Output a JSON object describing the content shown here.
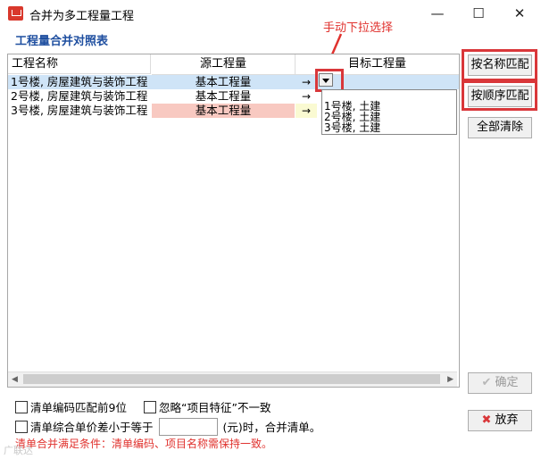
{
  "window": {
    "title": "合并为多工程量工程",
    "controls": {
      "minimize": "—",
      "maximize": "☐",
      "close": "✕"
    }
  },
  "section_title": "工程量合并对照表",
  "annotation": "手动下拉选择",
  "table": {
    "headers": [
      "工程名称",
      "源工程量",
      "目标工程量"
    ],
    "rows": [
      {
        "name": "1号楼, 房屋建筑与装饰工程",
        "source": "基本工程量",
        "arrow": "→",
        "target": ""
      },
      {
        "name": "2号楼, 房屋建筑与装饰工程",
        "source": "基本工程量",
        "arrow": "→",
        "target": ""
      },
      {
        "name": "3号楼, 房屋建筑与装饰工程",
        "source": "基本工程量",
        "arrow": "→",
        "target": ""
      }
    ],
    "dropdown_options": [
      "1号楼, 土建",
      "2号楼, 土建",
      "3号楼, 土建"
    ]
  },
  "buttons": {
    "match_by_name": "按名称匹配",
    "match_by_order": "按顺序匹配",
    "clear_all": "全部清除",
    "confirm": "确定",
    "abandon": "放弃"
  },
  "options": {
    "code_match": "清单编码匹配前9位",
    "ignore_feature": "忽略“项目特征”不一致",
    "price_diff_prefix": "清单综合单价差小于等于",
    "price_diff_value": "",
    "price_diff_suffix": "(元)时，合并清单。"
  },
  "note": "清单合并满足条件：清单编码、项目名称需保持一致。",
  "watermark": "广联达",
  "colors": {
    "accent_red": "#d9373a",
    "title_blue": "#1f4fa0",
    "row_highlight": "#cfe4f7",
    "source_highlight": "#f8c9c1",
    "arrow_highlight": "#fafad2"
  }
}
